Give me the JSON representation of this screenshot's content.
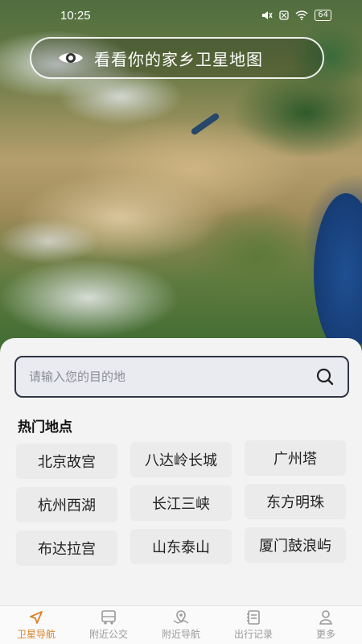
{
  "status": {
    "time": "10:25",
    "battery": "64"
  },
  "banner": {
    "text": "看看你的家乡卫星地图",
    "icon": "eye-icon"
  },
  "search": {
    "placeholder": "请输入您的目的地",
    "value": "",
    "icon": "search-icon"
  },
  "hot_places": {
    "title": "热门地点",
    "items": [
      "北京故宫",
      "八达岭长城",
      "广州塔",
      "杭州西湖",
      "长江三峡",
      "东方明珠",
      "布达拉宫",
      "山东泰山",
      "厦门鼓浪屿"
    ]
  },
  "nav": {
    "active_color": "#d9822b",
    "items": [
      {
        "label": "卫星导航",
        "icon": "navigation-arrow-icon"
      },
      {
        "label": "附近公交",
        "icon": "bus-icon"
      },
      {
        "label": "附近导航",
        "icon": "map-pin-icon"
      },
      {
        "label": "出行记录",
        "icon": "record-book-icon"
      },
      {
        "label": "更多",
        "icon": "person-icon"
      }
    ]
  }
}
